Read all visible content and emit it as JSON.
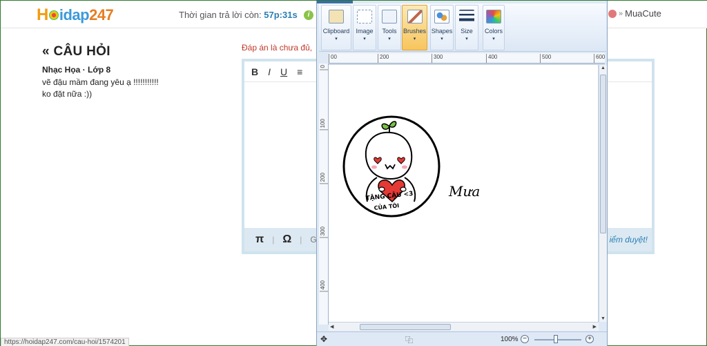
{
  "site": {
    "logo": {
      "first": "H",
      "middle": "idap",
      "suffix": "247"
    },
    "timer_label": "Thời gian trả lời còn:",
    "timer_value": "57p:31s",
    "info_icon": "i",
    "user_name": "MuaCute",
    "user_chevron": "»"
  },
  "question": {
    "back_icon": "«",
    "title": "CÂU HỎI",
    "meta": "Nhạc Họa · Lớp 8",
    "body": "vẽ đậu mầm đang yêu ạ !!!!!!!!!!!\nko đặt nữa :))"
  },
  "answer": {
    "warning": "Đáp án là chưa đủ,",
    "toolbar": {
      "bold": "B",
      "italic": "I",
      "underline": "U",
      "list": "≡"
    },
    "bottom": {
      "pi": "π",
      "omega": "Ω",
      "sep": "|",
      "more": "G"
    },
    "review_note": "iểm duyệt!"
  },
  "status_url": "https://hoidap247.com/cau-hoi/1574201",
  "paint": {
    "ribbon": [
      {
        "label": "Clipboard",
        "icon": "clipboard-icon"
      },
      {
        "label": "Image",
        "icon": "image-icon"
      },
      {
        "label": "Tools",
        "icon": "tools-icon"
      },
      {
        "label": "Brushes",
        "icon": "brush-icon",
        "active": true
      },
      {
        "label": "Shapes",
        "icon": "shapes-icon"
      },
      {
        "label": "Size",
        "icon": "size-icon"
      },
      {
        "label": "Colors",
        "icon": "colors-icon"
      }
    ],
    "ruler_h": [
      "00",
      "200",
      "300",
      "400",
      "500",
      "600"
    ],
    "ruler_v": [
      "0",
      "100",
      "200",
      "300",
      "400"
    ],
    "drawing": {
      "caption": "TẶNG CẬU <3",
      "caption2": "CỦA TÔI",
      "signature": "Mưa"
    },
    "zoom": "100%",
    "zoom_minus": "−",
    "zoom_plus": "+"
  }
}
